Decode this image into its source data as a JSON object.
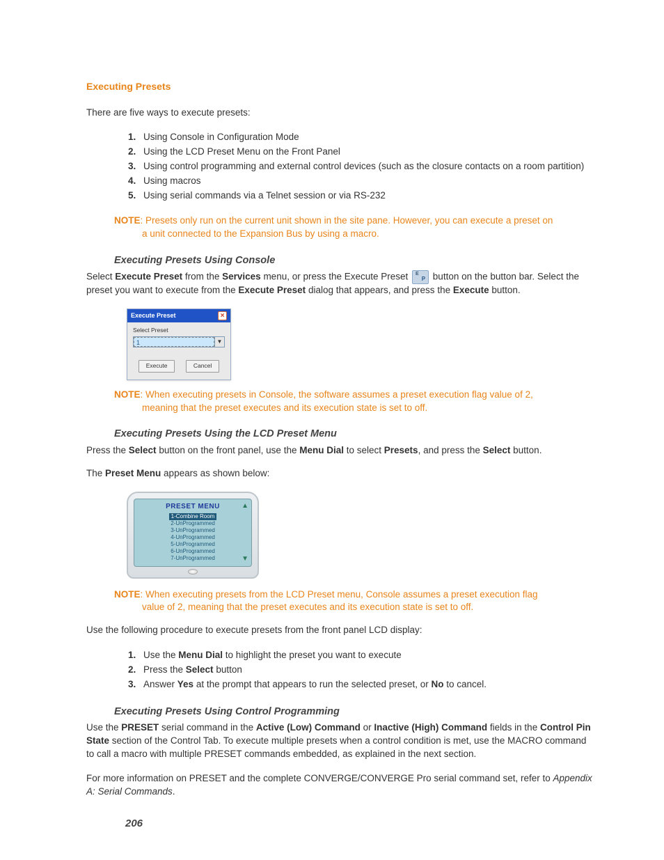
{
  "headings": {
    "main": "Executing Presets",
    "console": "Executing Presets Using Console",
    "lcd": "Executing Presets Using the LCD Preset Menu",
    "control": "Executing Presets Using Control Programming"
  },
  "intro": "There are five ways to execute presets:",
  "ways": [
    "Using Console in Configuration Mode",
    "Using the LCD Preset Menu on the Front Panel",
    "Using control programming and external control devices (such as the closure contacts on a room partition)",
    "Using macros",
    "Using serial commands via a Telnet session or via RS-232"
  ],
  "notes": {
    "label": "NOTE",
    "n1": ": Presets only run on the current unit shown in the site pane. However, you can execute a preset on a unit connected to the Expansion Bus by using a macro.",
    "n2": ": When executing presets in Console, the software assumes a preset execution flag value of 2, meaning that the preset executes and its execution state is set to off.",
    "n3": ": When executing presets from the LCD Preset menu, Console assumes a preset execution flag value of 2, meaning that the preset executes and its execution state is set to off."
  },
  "console_para": {
    "t1": "Select ",
    "b1": "Execute Preset",
    "t2": " from the ",
    "b2": "Services",
    "t3": " menu, or press the Execute Preset ",
    "t4": " button on the button bar. Select the preset you want to execute from the ",
    "b3": "Execute Preset",
    "t5": " dialog that appears, and press the ",
    "b4": "Execute",
    "t6": " button."
  },
  "dialog": {
    "title": "Execute Preset",
    "label": "Select Preset",
    "value": "1",
    "execute": "Execute",
    "cancel": "Cancel"
  },
  "lcd_para1": {
    "t1": "Press the ",
    "b1": "Select",
    "t2": " button on the front panel, use the ",
    "b2": "Menu Dial",
    "t3": " to select ",
    "b3": "Presets",
    "t4": ", and press the ",
    "b4": "Select",
    "t5": " button."
  },
  "lcd_para2": {
    "t1": "The ",
    "b1": "Preset Menu",
    "t2": " appears as shown below:"
  },
  "lcd": {
    "title": "PRESET MENU",
    "items": [
      "1-Combine Room",
      "2-UnProgrammed",
      "3-UnProgrammed",
      "4-UnProgrammed",
      "5-UnProgrammed",
      "6-UnProgrammed",
      "7-UnProgrammed"
    ]
  },
  "lcd_procedure_intro": "Use the following procedure to execute presets from the front panel LCD display:",
  "lcd_steps": {
    "s1a": "Use the ",
    "s1b": "Menu Dial",
    "s1c": " to highlight the preset you want to execute",
    "s2a": "Press the ",
    "s2b": "Select",
    "s2c": " button",
    "s3a": "Answer ",
    "s3b": "Yes",
    "s3c": " at the prompt that appears to run the selected preset, or ",
    "s3d": "No",
    "s3e": " to cancel."
  },
  "control_para": {
    "t1": "Use the ",
    "b1": "PRESET",
    "t2": " serial command in the ",
    "b2": "Active (Low) Command",
    "t3": " or ",
    "b3": "Inactive (High) Command",
    "t4": " fields in the ",
    "b4": "Control Pin State",
    "t5": " section of the Control Tab. To execute multiple presets when a control condition is met, use the MACRO command to call a macro with multiple PRESET commands embedded, as explained in the next section."
  },
  "control_para2": {
    "t1": "For more information on PRESET and the complete CONVERGE/CONVERGE Pro serial command set, refer to ",
    "i1": "Appendix A: Serial Commands",
    "t2": "."
  },
  "page_number": "206"
}
